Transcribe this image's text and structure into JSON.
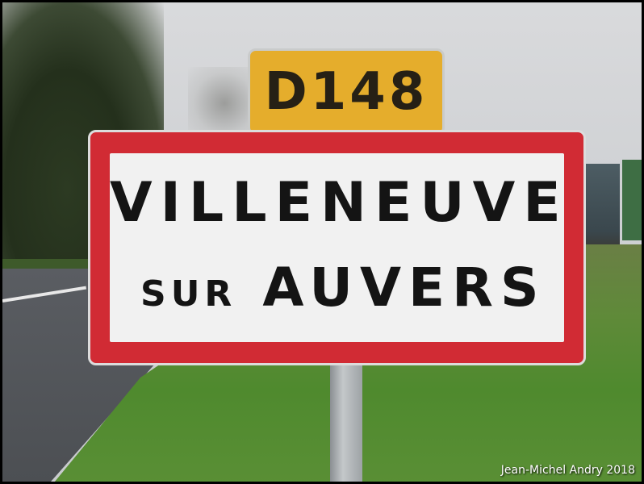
{
  "road_plate": {
    "text": "D148"
  },
  "town_sign": {
    "line1": "VILLENEUVE",
    "line2_small": "SUR",
    "line2_big": "AUVERS"
  },
  "credit": "Jean-Michel Andry 2018",
  "colors": {
    "sign_border": "#d12b34",
    "sign_face": "#f1f1f1",
    "plate": "#e5ad2c"
  }
}
